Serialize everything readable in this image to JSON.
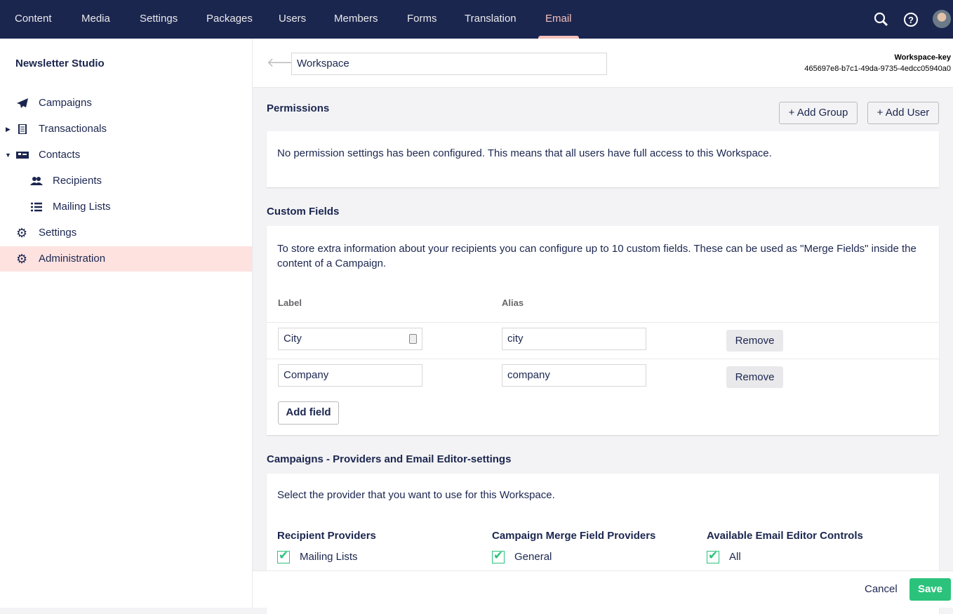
{
  "header": {
    "nav": [
      "Content",
      "Media",
      "Settings",
      "Packages",
      "Users",
      "Members",
      "Forms",
      "Translation",
      "Email"
    ],
    "active": "Email"
  },
  "sidebar": {
    "title": "Newsletter Studio",
    "items": [
      {
        "label": "Campaigns",
        "icon": "paper-plane-icon"
      },
      {
        "label": "Transactionals",
        "icon": "document-icon"
      },
      {
        "label": "Contacts",
        "icon": "id-card-icon"
      },
      {
        "label": "Recipients",
        "icon": "users-icon"
      },
      {
        "label": "Mailing Lists",
        "icon": "list-icon"
      },
      {
        "label": "Settings",
        "icon": "gear-icon"
      },
      {
        "label": "Administration",
        "icon": "gear-icon"
      }
    ]
  },
  "workspace": {
    "name": "Workspace",
    "key_label": "Workspace-key",
    "key": "465697e8-b7c1-49da-9735-4edcc05940a0"
  },
  "permissions": {
    "title": "Permissions",
    "add_group": "+ Add Group",
    "add_user": "+ Add User",
    "message": "No permission settings has been configured. This means that all users have full access to this Workspace."
  },
  "custom_fields": {
    "title": "Custom Fields",
    "description": "To store extra information about your recipients you can configure up to 10 custom fields. These can be used as \"Merge Fields\" inside the content of a Campaign.",
    "col_label": "Label",
    "col_alias": "Alias",
    "rows": [
      {
        "label": "City",
        "alias": "city",
        "remove": "Remove"
      },
      {
        "label": "Company",
        "alias": "company",
        "remove": "Remove"
      }
    ],
    "add_field": "Add field"
  },
  "campaigns": {
    "title": "Campaigns - Providers and Email Editor-settings",
    "description": "Select the provider that you want to use for this Workspace.",
    "columns": [
      {
        "heading": "Recipient Providers",
        "option": "Mailing Lists",
        "checked": true
      },
      {
        "heading": "Campaign Merge Field Providers",
        "option": "General",
        "checked": true
      },
      {
        "heading": "Available Email Editor Controls",
        "option": "All",
        "checked": true
      }
    ]
  },
  "footer": {
    "cancel": "Cancel",
    "save": "Save"
  },
  "colors": {
    "header": "#1b264f",
    "accent": "#f5c1bc",
    "save": "#2bc37c",
    "selected": "#fde2e0"
  }
}
